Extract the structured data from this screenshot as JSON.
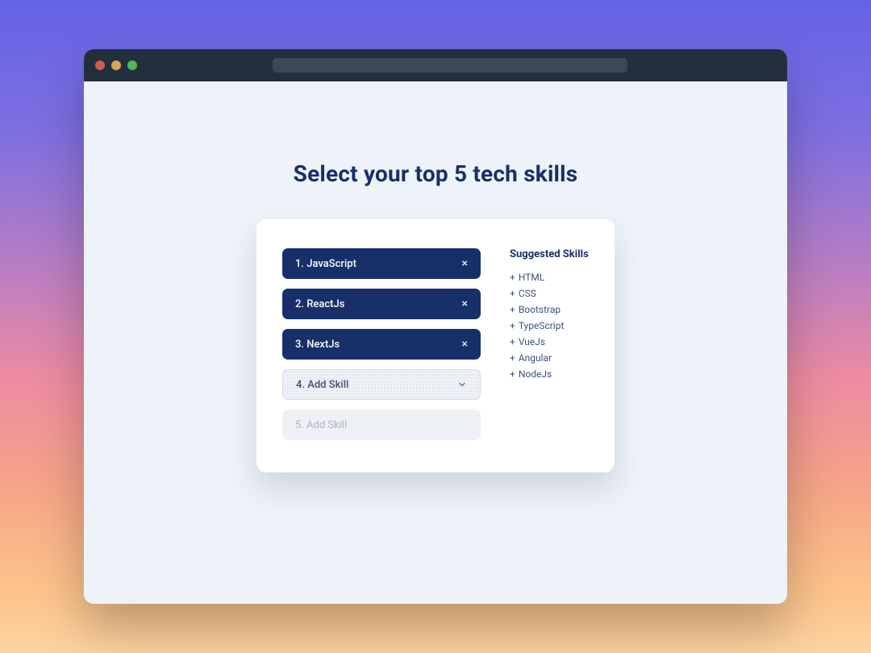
{
  "page": {
    "title": "Select your top 5 tech skills"
  },
  "skills": {
    "selected": [
      {
        "label": "1. JavaScript"
      },
      {
        "label": "2. ReactJs"
      },
      {
        "label": "3. NextJs"
      }
    ],
    "active_slot": {
      "label": "4. Add Skill"
    },
    "disabled_slot": {
      "label": "5. Add Skill"
    }
  },
  "suggested": {
    "title": "Suggested Skills",
    "items": [
      "HTML",
      "CSS",
      "Bootstrap",
      "TypeScript",
      "VueJs",
      "Angular",
      "NodeJs"
    ]
  }
}
